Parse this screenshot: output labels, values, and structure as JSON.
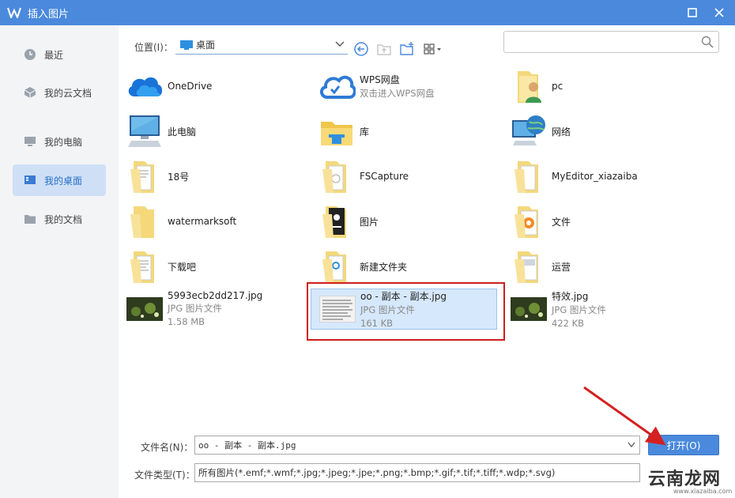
{
  "window": {
    "title": "插入图片"
  },
  "sidebar": {
    "items": [
      {
        "label": "最近",
        "icon": "clock-icon"
      },
      {
        "label": "我的云文档",
        "icon": "cube-icon"
      },
      {
        "label": "我的电脑",
        "icon": "monitor-icon"
      },
      {
        "label": "我的桌面",
        "icon": "desktop-icon",
        "active": true
      },
      {
        "label": "我的文档",
        "icon": "folder-icon"
      }
    ]
  },
  "toolbar": {
    "location_label": "位置(I)：",
    "location_value": "桌面",
    "search_placeholder": ""
  },
  "files": [
    {
      "name": "OneDrive",
      "sub1": "",
      "sub2": "",
      "icon": "onedrive-icon"
    },
    {
      "name": "WPS网盘",
      "sub1": "双击进入WPS网盘",
      "sub2": "",
      "icon": "wps-cloud-icon"
    },
    {
      "name": "pc",
      "sub1": "",
      "sub2": "",
      "icon": "user-folder-icon"
    },
    {
      "name": "此电脑",
      "sub1": "",
      "sub2": "",
      "icon": "computer-icon"
    },
    {
      "name": "库",
      "sub1": "",
      "sub2": "",
      "icon": "library-icon"
    },
    {
      "name": "网络",
      "sub1": "",
      "sub2": "",
      "icon": "network-icon"
    },
    {
      "name": "18号",
      "sub1": "",
      "sub2": "",
      "icon": "folder-icon"
    },
    {
      "name": "FSCapture",
      "sub1": "",
      "sub2": "",
      "icon": "folder-icon"
    },
    {
      "name": "MyEditor_xiazaiba",
      "sub1": "",
      "sub2": "",
      "icon": "folder-icon"
    },
    {
      "name": "watermarksoft",
      "sub1": "",
      "sub2": "",
      "icon": "folder-icon"
    },
    {
      "name": "图片",
      "sub1": "",
      "sub2": "",
      "icon": "folder-image-icon"
    },
    {
      "name": "文件",
      "sub1": "",
      "sub2": "",
      "icon": "folder-doc-icon"
    },
    {
      "name": "下载吧",
      "sub1": "",
      "sub2": "",
      "icon": "folder-icon"
    },
    {
      "name": "新建文件夹",
      "sub1": "",
      "sub2": "",
      "icon": "folder-icon"
    },
    {
      "name": "运营",
      "sub1": "",
      "sub2": "",
      "icon": "folder-icon"
    },
    {
      "name": "5993ecb2dd217.jpg",
      "sub1": "JPG 图片文件",
      "sub2": "1.58 MB",
      "icon": "image-thumb-icon"
    },
    {
      "name": "oo - 副本 - 副本.jpg",
      "sub1": "JPG 图片文件",
      "sub2": "161 KB",
      "icon": "document-thumb-icon",
      "selected": true
    },
    {
      "name": "特效.jpg",
      "sub1": "JPG 图片文件",
      "sub2": "422 KB",
      "icon": "image-thumb-icon"
    }
  ],
  "bottom": {
    "filename_label": "文件名(N)：",
    "filename_value": "oo - 副本 - 副本.jpg",
    "filetype_label": "文件类型(T)：",
    "filetype_value": "所有图片(*.emf;*.wmf;*.jpg;*.jpeg;*.jpe;*.png;*.bmp;*.gif;*.tif;*.tiff;*.wdp;*.svg)",
    "open_label": "打开(O)"
  },
  "watermark": {
    "text": "云南龙网",
    "sub": "www.xiazaiba.com"
  },
  "colors": {
    "accent": "#4a89dc",
    "selected_bg": "#d6e8fb",
    "highlight_box": "#cc1f1f"
  }
}
